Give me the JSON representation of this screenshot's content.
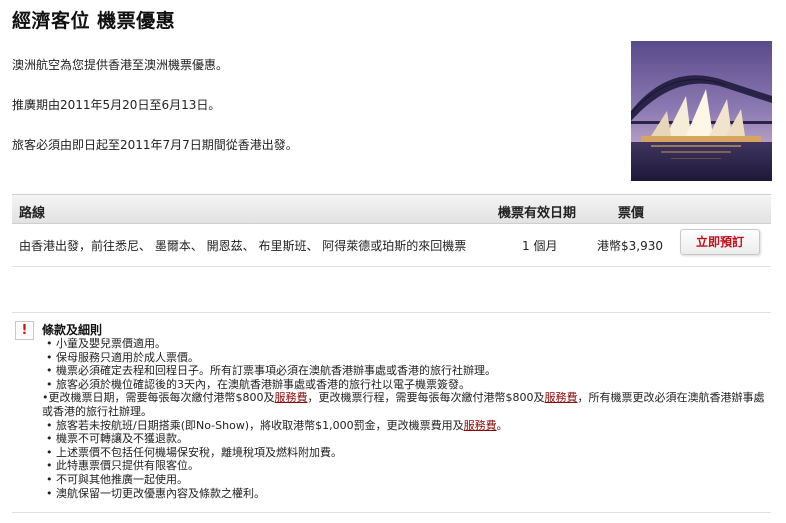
{
  "page": {
    "title": "經濟客位 機票優惠",
    "intro": [
      "澳洲航空為您提供香港至澳洲機票優惠。",
      "推廣期由2011年5月20日至6月13日。",
      "旅客必須由即日起至2011年7月7日期間從香港出發。"
    ]
  },
  "table": {
    "headers": {
      "route": "路線",
      "validity": "機票有效日期",
      "price": "票價"
    },
    "rows": [
      {
        "route": "由香港出發，前往悉尼、 墨爾本、 開恩茲、 布里斯班、 阿得萊德或珀斯的來回機票",
        "validity": "1 個月",
        "price": "港幣$3,930",
        "button": "立即預訂"
      }
    ]
  },
  "terms": {
    "icon_symbol": "!",
    "icon_name": "alert-icon",
    "title": "條款及細則",
    "bullet": "•",
    "items": [
      {
        "text": "小童及嬰兒票價適用。"
      },
      {
        "text": "保母服務只適用於成人票價。"
      },
      {
        "text": "機票必須確定去程和回程日子。所有訂票事項必須在澳航香港辦事處或香港的旅行社辦理。"
      },
      {
        "text": "旅客必須於機位確認後的3天內，在澳航香港辦事處或香港的旅行社以電子機票簽發。"
      },
      {
        "text_a": "更改機票日期，需要每張每次繳付港幣$800及",
        "link_a": "服務費",
        "text_b": "，更改機票行程，需要每張每次繳付港幣$800及",
        "link_b": "服務費",
        "text_c": "，所有機票更改必須在澳航香港辦事處或香港的旅行社辦理。"
      },
      {
        "text_a": "旅客若未按航班/日期搭乘(即No-Show)，將收取港幣$1,000罰金，更改機票費用及",
        "link_a": "服務費",
        "text_b": "。"
      },
      {
        "text": "機票不可轉讓及不獲退款。"
      },
      {
        "text": "上述票價不包括任何機場保安稅，離境稅項及燃料附加費。"
      },
      {
        "text": "此特惠票價只提供有限客位。"
      },
      {
        "text": "不可與其他推廣一起使用。"
      },
      {
        "text": "澳航保留一切更改優惠內容及條款之權利。"
      }
    ]
  },
  "colors": {
    "accent_red": "#c0101a",
    "link_red": "#8b0a0a",
    "header_gray": "#e8e8e8"
  }
}
